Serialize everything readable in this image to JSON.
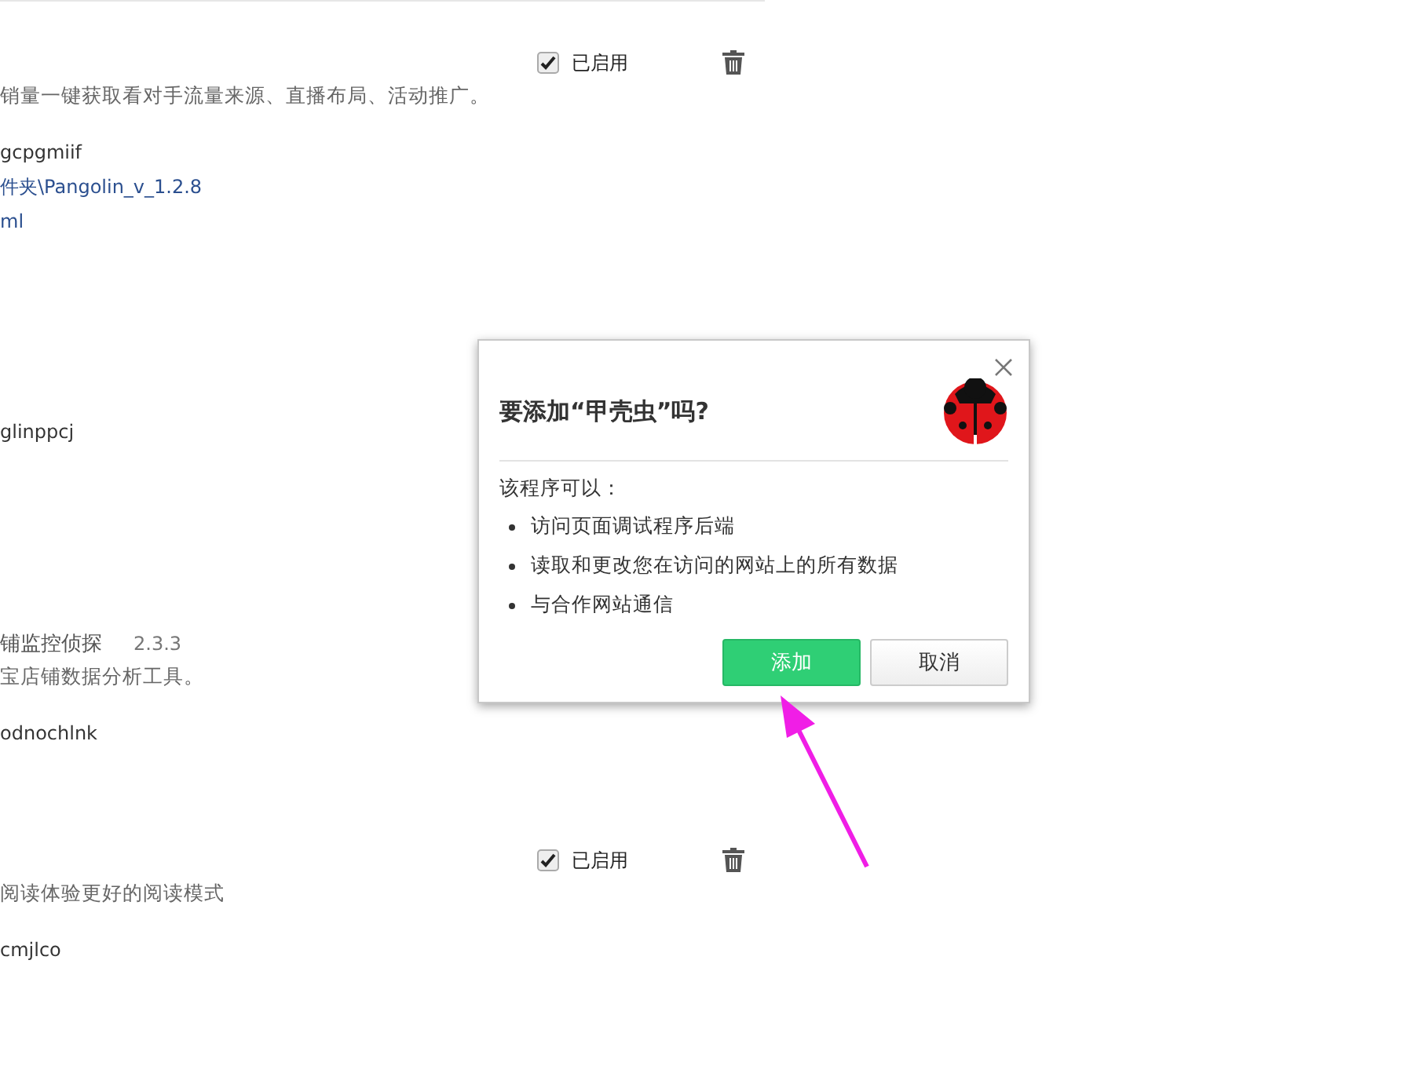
{
  "extensions": [
    {
      "enabled": true,
      "status": "已启用",
      "description": "销量一键获取看对手流量来源、直播布局、活动推广。",
      "id": "gcpgmiif",
      "links": [
        "件夹\\Pangolin_v_1.2.8",
        "ml"
      ]
    },
    {
      "id": "glinppcj"
    },
    {
      "name": "铺监控侦探",
      "version": "2.3.3",
      "description": "宝店铺数据分析工具。",
      "id": "odnochlnk"
    },
    {
      "enabled": true,
      "status": "已启用",
      "description": "阅读体验更好的阅读模式",
      "id": "cmjlco"
    }
  ],
  "dialog": {
    "title": "要添加“甲壳虫”吗?",
    "intro": "该程序可以：",
    "permissions": [
      "访问页面调试程序后端",
      "读取和更改您在访问的网站上的所有数据",
      "与合作网站通信"
    ],
    "buttons": [
      {
        "label": "添加",
        "kind": "primary"
      },
      {
        "label": "取消",
        "kind": "secondary"
      }
    ]
  }
}
